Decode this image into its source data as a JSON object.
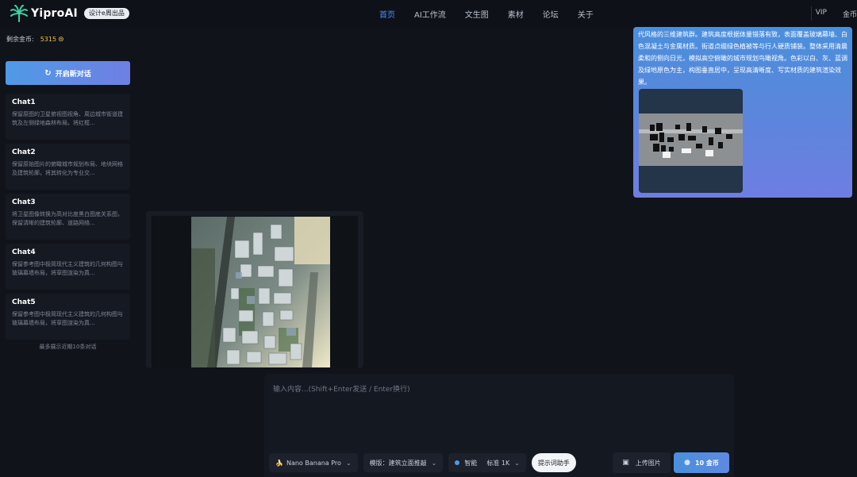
{
  "header": {
    "brand": "YiproAI",
    "badge": "设计e周出品",
    "nav": [
      {
        "label": "首页",
        "active": true
      },
      {
        "label": "AI工作流"
      },
      {
        "label": "文生图"
      },
      {
        "label": "素材"
      },
      {
        "label": "论坛"
      },
      {
        "label": "关于"
      }
    ],
    "vip": "VIP",
    "coins_link": "金币"
  },
  "sidebar": {
    "coins_label": "剩余金币:",
    "coins_value": "5315",
    "new_chat_label": "开启新对话",
    "chats": [
      {
        "title": "Chat1",
        "preview": "保留原图的卫星俯视图视角、周边城市街道建筑及左侧绿地森林布局。将红框..."
      },
      {
        "title": "Chat2",
        "preview": "保留原始图片的俯瞰城市规划布局、地块网格及建筑轮廓，将其转化为专业交..."
      },
      {
        "title": "Chat3",
        "preview": "将卫星图像转换为高对比度黑白图底关系图，保留清晰的建筑轮廓、道路网络..."
      },
      {
        "title": "Chat4",
        "preview": "保留参考图中极简现代主义建筑的几何构图与玻璃幕墙布局，将草图渲染为真..."
      },
      {
        "title": "Chat5",
        "preview": "保留参考图中极简现代主义建筑的几何构图与玻璃幕墙布局，将草图渲染为真..."
      }
    ],
    "note": "最多展示近期10条对话"
  },
  "message": {
    "text": "代风格的三维建筑群。建筑高度根据体量错落有致，表面覆盖玻璃幕墙、白色混凝土与金属材质。街道点缀绿色植被等与行人硬质铺装。整体采用清晨柔和的侧向日光，模拟高空俯瞰的城市规划鸟瞰视角。色彩以白、灰、蓝调及绿地原色为主，构图垂直居中，呈现高清晰度、写实材质的建筑渲染效果。"
  },
  "input": {
    "placeholder": "输入内容...(Shift+Enter发送 / Enter换行)",
    "model": "Nano Banana Pro",
    "template": "模版：建筑立面推敲",
    "mode": "智能",
    "quality": "标准 1K",
    "prompt_helper": "提示词助手",
    "upload": "上传图片",
    "send": "10 金币"
  },
  "colors": {
    "accent": "#4f8cff",
    "gold": "#f0c24b"
  }
}
